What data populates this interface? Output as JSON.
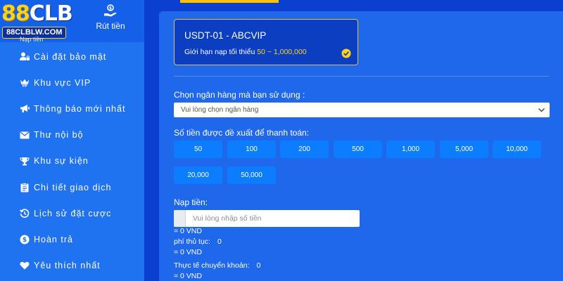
{
  "header": {
    "logo_digits": "88",
    "logo_letters": "CLB",
    "logo_domain": "88CLBLW.COM",
    "deposit_label_partial": "Nạp tiền",
    "withdraw_label": "Rút tiền"
  },
  "sidebar": {
    "items": [
      {
        "label": "Cài đặt bảo mật",
        "icon": "user-lock-icon"
      },
      {
        "label": "Khu vực VIP",
        "icon": "vip-crown-icon"
      },
      {
        "label": "Thông báo mới nhất",
        "icon": "megaphone-icon"
      },
      {
        "label": "Thư nội bộ",
        "icon": "envelope-icon"
      },
      {
        "label": "Khu sự kiện",
        "icon": "trophy-icon"
      },
      {
        "label": "Chi tiết giao dịch",
        "icon": "clipboard-icon"
      },
      {
        "label": "Lịch sử đặt cược",
        "icon": "history-icon"
      },
      {
        "label": "Hoàn trả",
        "icon": "cashback-icon"
      },
      {
        "label": "Yêu thích nhất",
        "icon": "heart-icon"
      }
    ]
  },
  "channel": {
    "name": "USDT-01 - ABCVIP",
    "limit_label": "Giới hạn nạp tối thiểu",
    "limit_range": "50 ~ 1,000,000",
    "selected": true
  },
  "form": {
    "bank_label": "Chọn ngân hàng mà bạn sử dụng :",
    "bank_placeholder": "Vui lòng chọn ngân hàng",
    "suggest_label": "Số tiền được đề xuất để thanh toán:",
    "amounts": [
      "50",
      "100",
      "200",
      "500",
      "1,000",
      "5,000",
      "10,000",
      "20,000",
      "50,000"
    ],
    "deposit_label": "Nạp tiền:",
    "deposit_placeholder": "Vui lòng nhập số tiền",
    "deposit_equiv": "= 0 VND",
    "fee_label": "phí thủ tục:",
    "fee_value": "0",
    "fee_equiv": "= 0 VND",
    "actual_label": "Thực tế chuyển khoản:",
    "actual_value": "0",
    "actual_equiv": "= 0 VND"
  },
  "colors": {
    "background": "#0b3fd0",
    "sidebar": "#1f72f0",
    "panel": "#1f68ec",
    "card": "#0c3ec2",
    "amount_button": "#0d7dff",
    "accent_gold": "#ffd21a"
  }
}
